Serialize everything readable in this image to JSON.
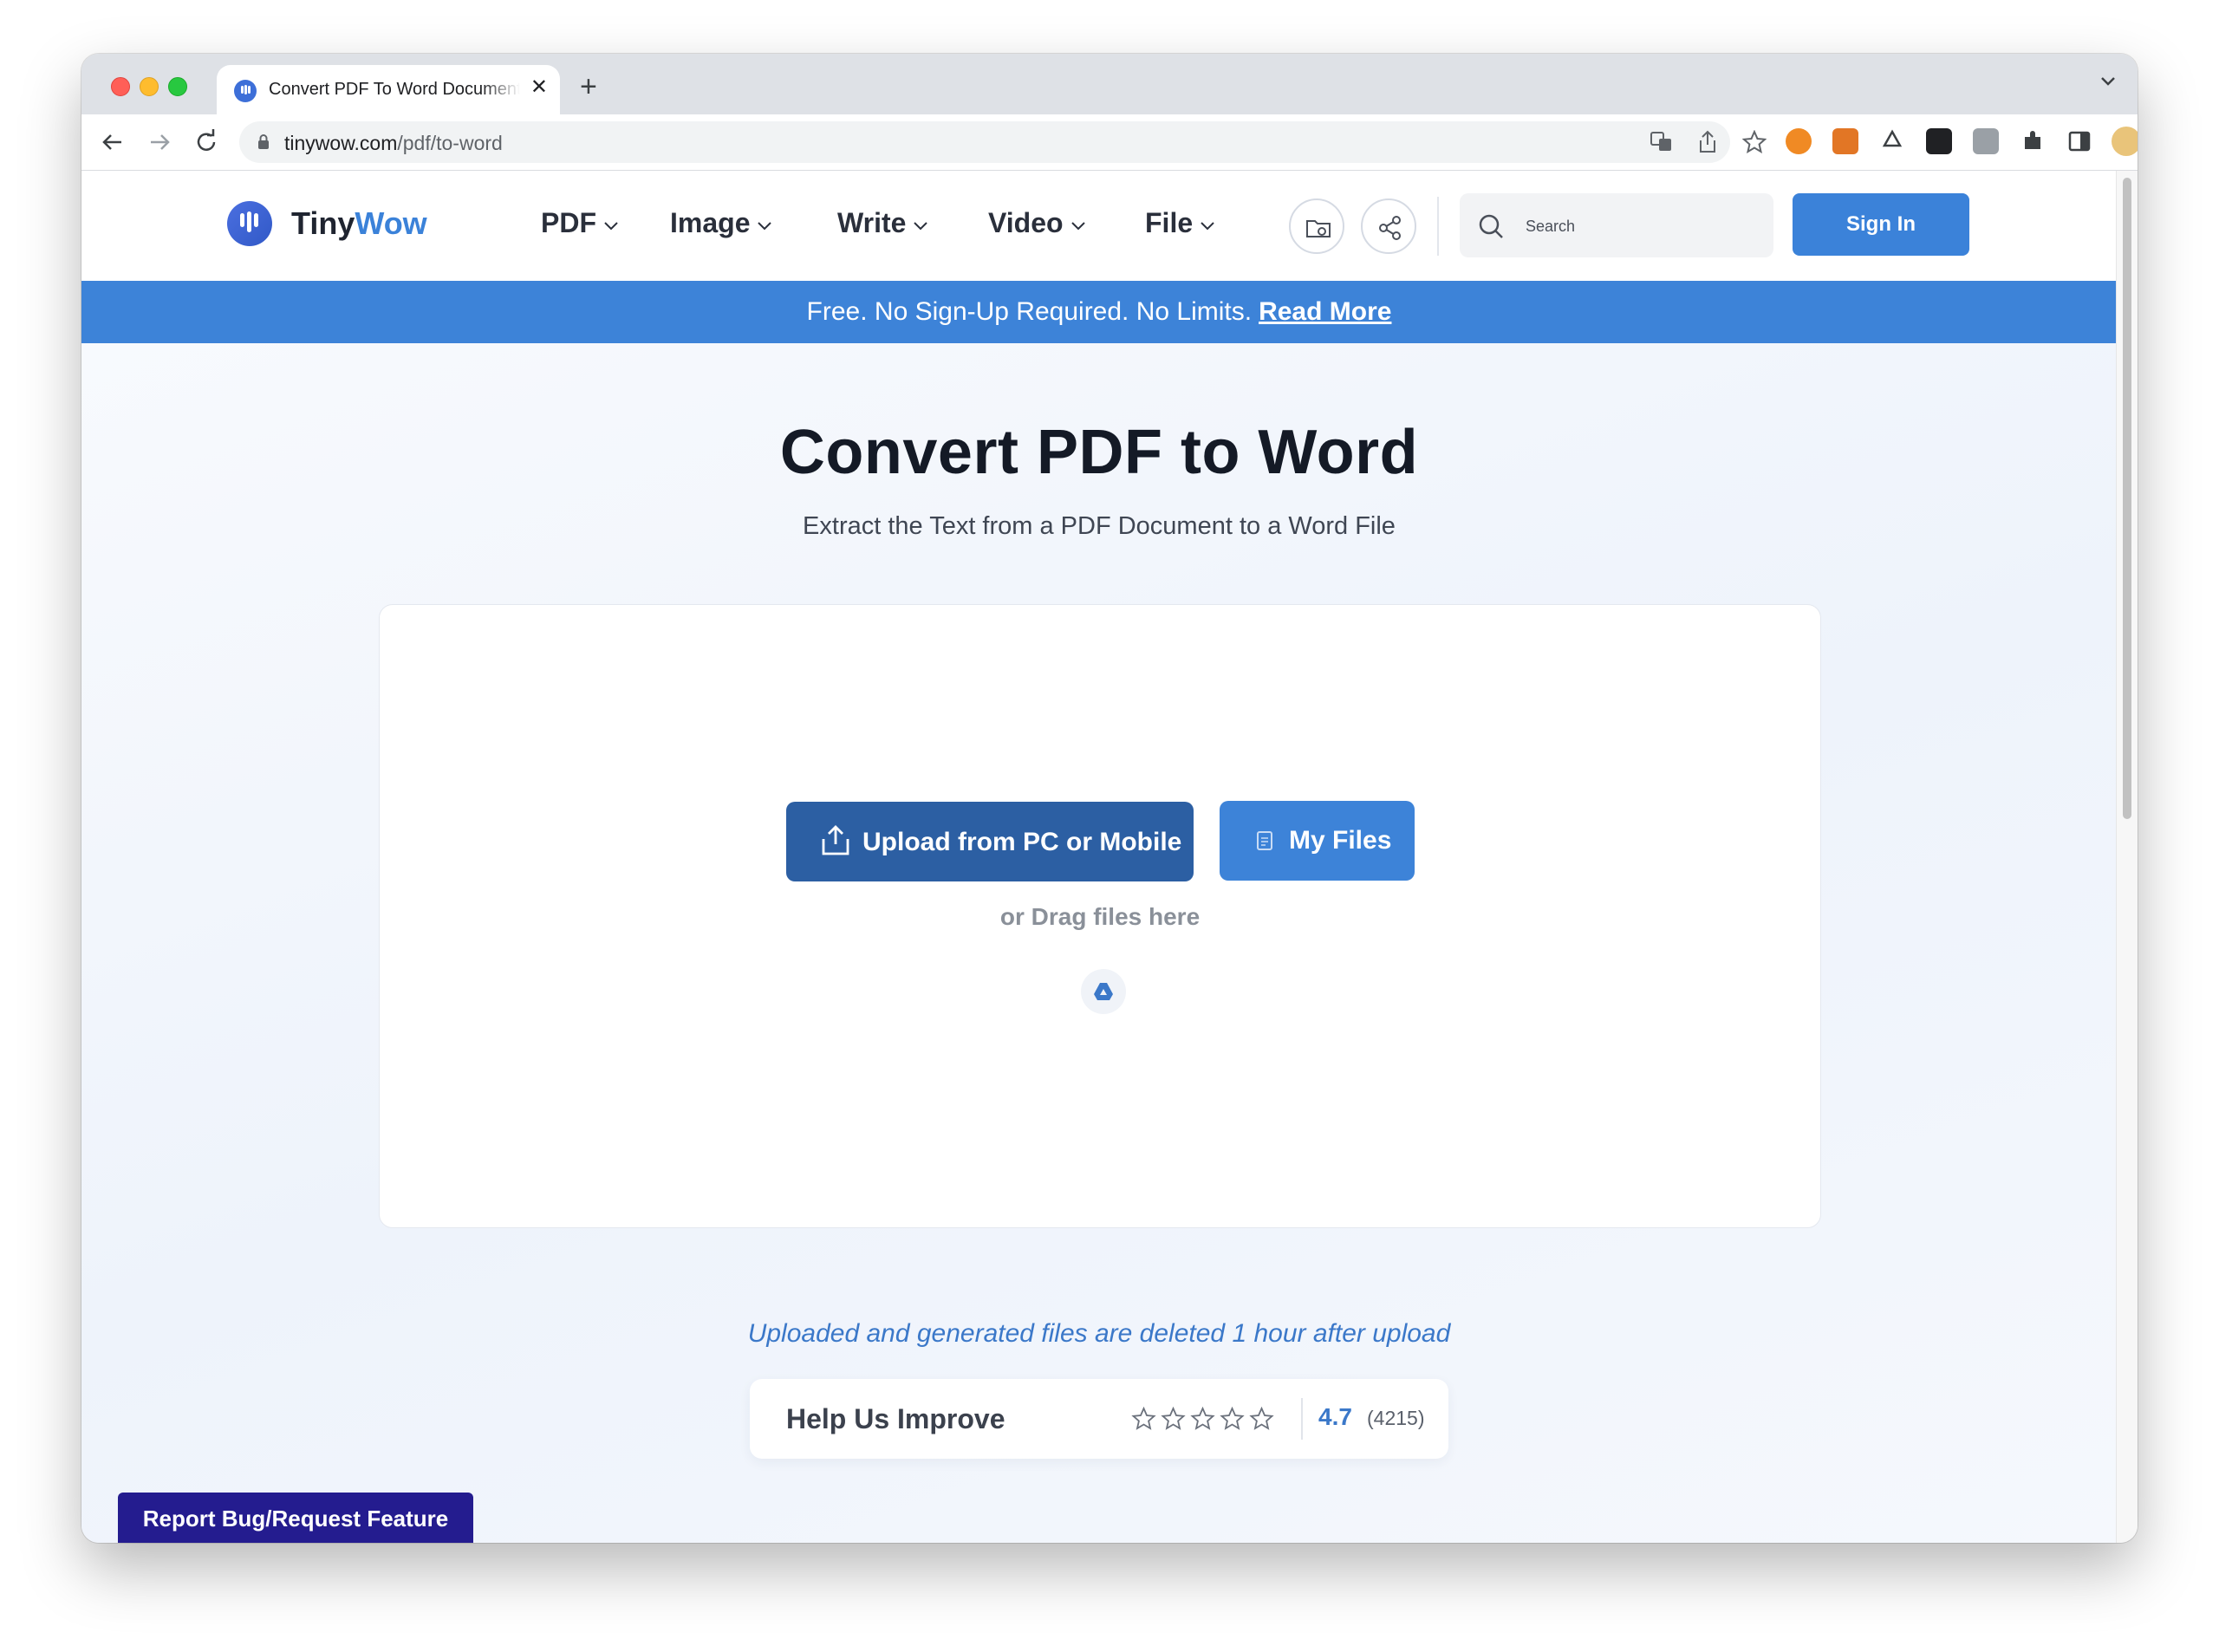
{
  "browser": {
    "tab_title": "Convert PDF To Word Document",
    "tab_close": "✕",
    "new_tab": "+",
    "url_host": "tinywow.com",
    "url_path": "/pdf/to-word"
  },
  "site": {
    "logo_part1": "Tiny",
    "logo_part2": "Wow",
    "nav": [
      "PDF",
      "Image",
      "Write",
      "Video",
      "File"
    ],
    "search_placeholder": "Search",
    "signin_label": "Sign In",
    "banner_text": "Free. No Sign-Up Required. No Limits.",
    "banner_link": "Read More"
  },
  "hero": {
    "title": "Convert PDF to Word",
    "subtitle": "Extract the Text from a PDF Document to a Word File"
  },
  "upload": {
    "upload_label": "Upload from PC or Mobile",
    "myfiles_label": "My Files",
    "drag_hint": "or Drag files here"
  },
  "notice": "Uploaded and generated files are deleted 1 hour after upload",
  "rating": {
    "title": "Help Us Improve",
    "score": "4.7",
    "count": "(4215)",
    "stars_total": 5
  },
  "report_label": "Report Bug/Request Feature",
  "colors": {
    "brand_blue": "#3b82d9",
    "upload_button": "#2c5fa3",
    "report_button": "#241c8f"
  }
}
